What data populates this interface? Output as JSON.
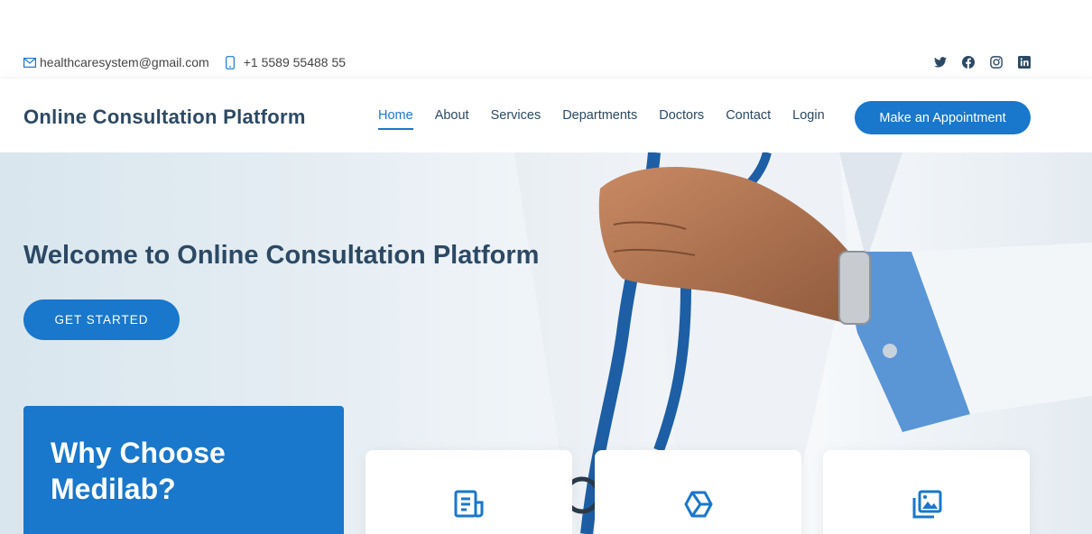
{
  "topbar": {
    "email": "healthcaresystem@gmail.com",
    "phone": "+1 5589 55488 55",
    "social": [
      "twitter-icon",
      "facebook-icon",
      "instagram-icon",
      "linkedin-icon"
    ]
  },
  "header": {
    "logo": "Online Consultation Platform",
    "nav": [
      "Home",
      "About",
      "Services",
      "Departments",
      "Doctors",
      "Contact",
      "Login"
    ],
    "active_nav": "Home",
    "appointment_label": "Make an Appointment"
  },
  "hero": {
    "title": "Welcome to Online Consultation Platform",
    "cta_label": "GET STARTED"
  },
  "why": {
    "title": "Why Choose Medilab?"
  },
  "cards": {
    "icons": [
      "document-icon",
      "cube-icon",
      "images-icon"
    ]
  },
  "colors": {
    "accent": "#1977cc",
    "text_dark": "#2c4964",
    "text_muted": "#444444"
  }
}
